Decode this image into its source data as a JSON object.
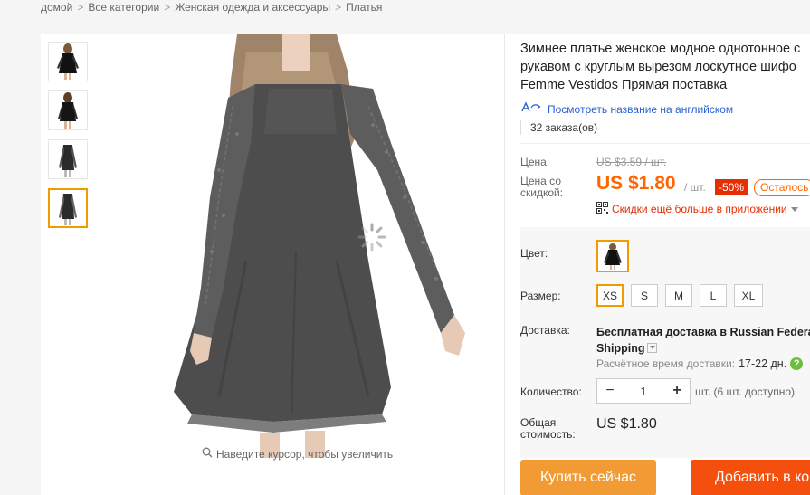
{
  "breadcrumb": [
    "домой",
    "Все категории",
    "Женская одежда и аксессуары",
    "Платья"
  ],
  "breadcrumb_sep": ">",
  "product": {
    "title_lines": [
      "Зимнее платье женское модное однотонное с",
      "рукавом с круглым вырезом лоскутное шифо",
      "Femme Vestidos Прямая поставка"
    ],
    "translate_link": "Посмотреть название на английском",
    "orders": "32 заказа(ов)"
  },
  "price": {
    "label": "Цена:",
    "old": "US $3.59 / шт.",
    "discount_label_1": "Цена со",
    "discount_label_2": "скидкой:",
    "new": "US $1.80",
    "per_unit": "/ шт.",
    "discount_badge": "-50%",
    "left_badge": "Осталось",
    "app_discount": "Скидки ещё больше в приложении"
  },
  "options": {
    "color_label": "Цвет:",
    "size_label": "Размер:",
    "sizes": [
      "XS",
      "S",
      "M",
      "L",
      "XL"
    ],
    "selected_size": "XS"
  },
  "shipping": {
    "label": "Доставка:",
    "main": "Бесплатная доставка в Russian Federat",
    "method": "Shipping",
    "eta_label": "Расчётное время доставки:",
    "eta_value": "17-22 дн."
  },
  "quantity": {
    "label": "Количество:",
    "value": "1",
    "note": "шт. (6 шт. доступно)",
    "minus": "−",
    "plus": "+"
  },
  "total": {
    "label_1": "Общая",
    "label_2": "стоимость:",
    "value": "US $1.80"
  },
  "buttons": {
    "buy": "Купить сейчас",
    "cart": "Добавить в ко"
  },
  "zoom_hint": "Наведите курсор, чтобы увеличить",
  "colors": {
    "accent": "#f29b00",
    "price": "#ff6600",
    "buy": "#f29b34",
    "cart": "#f44f0c",
    "link": "#2a61d4"
  }
}
